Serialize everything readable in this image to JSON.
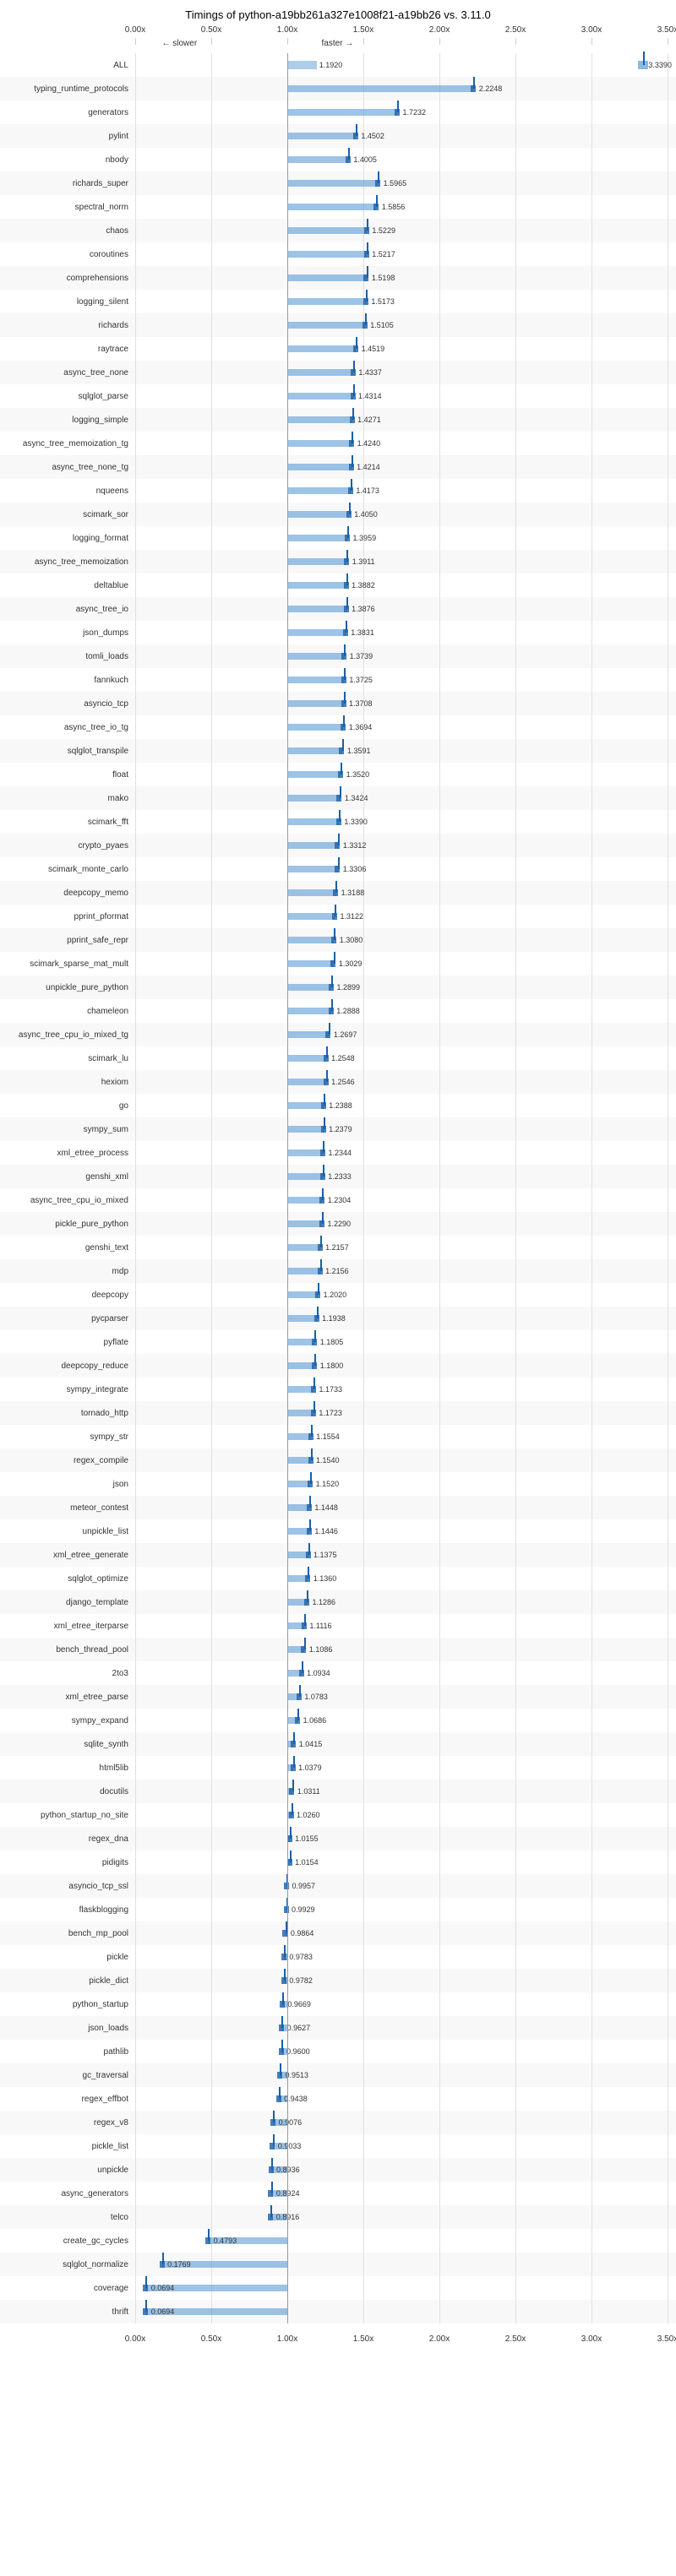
{
  "title": "Timings of python-a19bb261a327e1008f21-a19bb26 vs. 3.11.0",
  "axis": {
    "ticks": [
      0.0,
      0.5,
      1.0,
      1.5,
      2.0,
      2.5,
      3.0,
      3.5
    ],
    "labels": [
      "0.00x",
      "0.50x",
      "1.00x",
      "1.50x",
      "2.00x",
      "2.50x",
      "3.00x",
      "3.50x"
    ],
    "slower_label": "← slower",
    "faster_label": "faster →"
  },
  "rows": [
    {
      "name": "ALL",
      "value": 1.192,
      "value_label": "1.1920",
      "special": true,
      "special_value": 3.339
    },
    {
      "name": "typing_runtime_protocols",
      "value": 2.2248
    },
    {
      "name": "generators",
      "value": 1.7232
    },
    {
      "name": "pylint",
      "value": 1.4502
    },
    {
      "name": "nbody",
      "value": 1.4005
    },
    {
      "name": "richards_super",
      "value": 1.5965
    },
    {
      "name": "spectral_norm",
      "value": 1.5856
    },
    {
      "name": "chaos",
      "value": 1.5229
    },
    {
      "name": "coroutines",
      "value": 1.5217
    },
    {
      "name": "comprehensions",
      "value": 1.5198
    },
    {
      "name": "logging_silent",
      "value": 1.5173
    },
    {
      "name": "richards",
      "value": 1.5105
    },
    {
      "name": "raytrace",
      "value": 1.4519
    },
    {
      "name": "async_tree_none",
      "value": 1.4337
    },
    {
      "name": "sqlglot_parse",
      "value": 1.4314
    },
    {
      "name": "logging_simple",
      "value": 1.4271
    },
    {
      "name": "async_tree_memoization_tg",
      "value": 1.424
    },
    {
      "name": "async_tree_none_tg",
      "value": 1.4214
    },
    {
      "name": "nqueens",
      "value": 1.4173
    },
    {
      "name": "scimark_sor",
      "value": 1.405
    },
    {
      "name": "logging_format",
      "value": 1.3959
    },
    {
      "name": "async_tree_memoization",
      "value": 1.3911
    },
    {
      "name": "deltablue",
      "value": 1.3882
    },
    {
      "name": "async_tree_io",
      "value": 1.3876
    },
    {
      "name": "json_dumps",
      "value": 1.3831
    },
    {
      "name": "tomli_loads",
      "value": 1.3739
    },
    {
      "name": "fannkuch",
      "value": 1.3725
    },
    {
      "name": "asyncio_tcp",
      "value": 1.3708
    },
    {
      "name": "async_tree_io_tg",
      "value": 1.3694
    },
    {
      "name": "sqlglot_transpile",
      "value": 1.3591
    },
    {
      "name": "float",
      "value": 1.352
    },
    {
      "name": "mako",
      "value": 1.3424
    },
    {
      "name": "scimark_fft",
      "value": 1.339
    },
    {
      "name": "crypto_pyaes",
      "value": 1.3312
    },
    {
      "name": "scimark_monte_carlo",
      "value": 1.3306
    },
    {
      "name": "deepcopy_memo",
      "value": 1.3188
    },
    {
      "name": "pprint_pformat",
      "value": 1.3122
    },
    {
      "name": "pprint_safe_repr",
      "value": 1.308
    },
    {
      "name": "scimark_sparse_mat_mult",
      "value": 1.3029
    },
    {
      "name": "unpickle_pure_python",
      "value": 1.2899
    },
    {
      "name": "chameleon",
      "value": 1.2888
    },
    {
      "name": "async_tree_cpu_io_mixed_tg",
      "value": 1.2697
    },
    {
      "name": "scimark_lu",
      "value": 1.2548
    },
    {
      "name": "hexiom",
      "value": 1.2546
    },
    {
      "name": "go",
      "value": 1.2388
    },
    {
      "name": "sympy_sum",
      "value": 1.2379
    },
    {
      "name": "xml_etree_process",
      "value": 1.2344
    },
    {
      "name": "genshi_xml",
      "value": 1.2333
    },
    {
      "name": "async_tree_cpu_io_mixed",
      "value": 1.2304
    },
    {
      "name": "pickle_pure_python",
      "value": 1.229
    },
    {
      "name": "genshi_text",
      "value": 1.2157
    },
    {
      "name": "mdp",
      "value": 1.2156
    },
    {
      "name": "deepcopy",
      "value": 1.202
    },
    {
      "name": "pycparser",
      "value": 1.1938
    },
    {
      "name": "pyflate",
      "value": 1.1805
    },
    {
      "name": "deepcopy_reduce",
      "value": 1.18
    },
    {
      "name": "sympy_integrate",
      "value": 1.1733
    },
    {
      "name": "tornado_http",
      "value": 1.1723
    },
    {
      "name": "sympy_str",
      "value": 1.1554
    },
    {
      "name": "regex_compile",
      "value": 1.154
    },
    {
      "name": "json",
      "value": 1.152
    },
    {
      "name": "meteor_contest",
      "value": 1.1448
    },
    {
      "name": "unpickle_list",
      "value": 1.1446
    },
    {
      "name": "xml_etree_generate",
      "value": 1.1375
    },
    {
      "name": "sqlglot_optimize",
      "value": 1.136
    },
    {
      "name": "django_template",
      "value": 1.1286
    },
    {
      "name": "xml_etree_iterparse",
      "value": 1.1116
    },
    {
      "name": "bench_thread_pool",
      "value": 1.1086
    },
    {
      "name": "2to3",
      "value": 1.0934
    },
    {
      "name": "xml_etree_parse",
      "value": 1.0783
    },
    {
      "name": "sympy_expand",
      "value": 1.0686
    },
    {
      "name": "sqlite_synth",
      "value": 1.0415
    },
    {
      "name": "html5lib",
      "value": 1.0379
    },
    {
      "name": "docutils",
      "value": 1.0311
    },
    {
      "name": "python_startup_no_site",
      "value": 1.026
    },
    {
      "name": "regex_dna",
      "value": 1.0155
    },
    {
      "name": "pidigits",
      "value": 1.0154
    },
    {
      "name": "asyncio_tcp_ssl",
      "value": 0.9957
    },
    {
      "name": "flaskblogging",
      "value": 0.9929
    },
    {
      "name": "bench_mp_pool",
      "value": 0.9864
    },
    {
      "name": "pickle",
      "value": 0.9783
    },
    {
      "name": "pickle_dict",
      "value": 0.9782
    },
    {
      "name": "python_startup",
      "value": 0.9669
    },
    {
      "name": "json_loads",
      "value": 0.9627
    },
    {
      "name": "pathlib",
      "value": 0.96
    },
    {
      "name": "gc_traversal",
      "value": 0.9513
    },
    {
      "name": "regex_effbot",
      "value": 0.9438
    },
    {
      "name": "regex_v8",
      "value": 0.9076
    },
    {
      "name": "pickle_list",
      "value": 0.9033
    },
    {
      "name": "unpickle",
      "value": 0.8936
    },
    {
      "name": "async_generators",
      "value": 0.8924
    },
    {
      "name": "telco",
      "value": 0.8916
    },
    {
      "name": "create_gc_cycles",
      "value": 0.4793
    },
    {
      "name": "sqlglot_normalize",
      "value": 0.1769
    },
    {
      "name": "coverage",
      "value": 0.0694
    },
    {
      "name": "thrift",
      "value": 0.0694
    }
  ]
}
